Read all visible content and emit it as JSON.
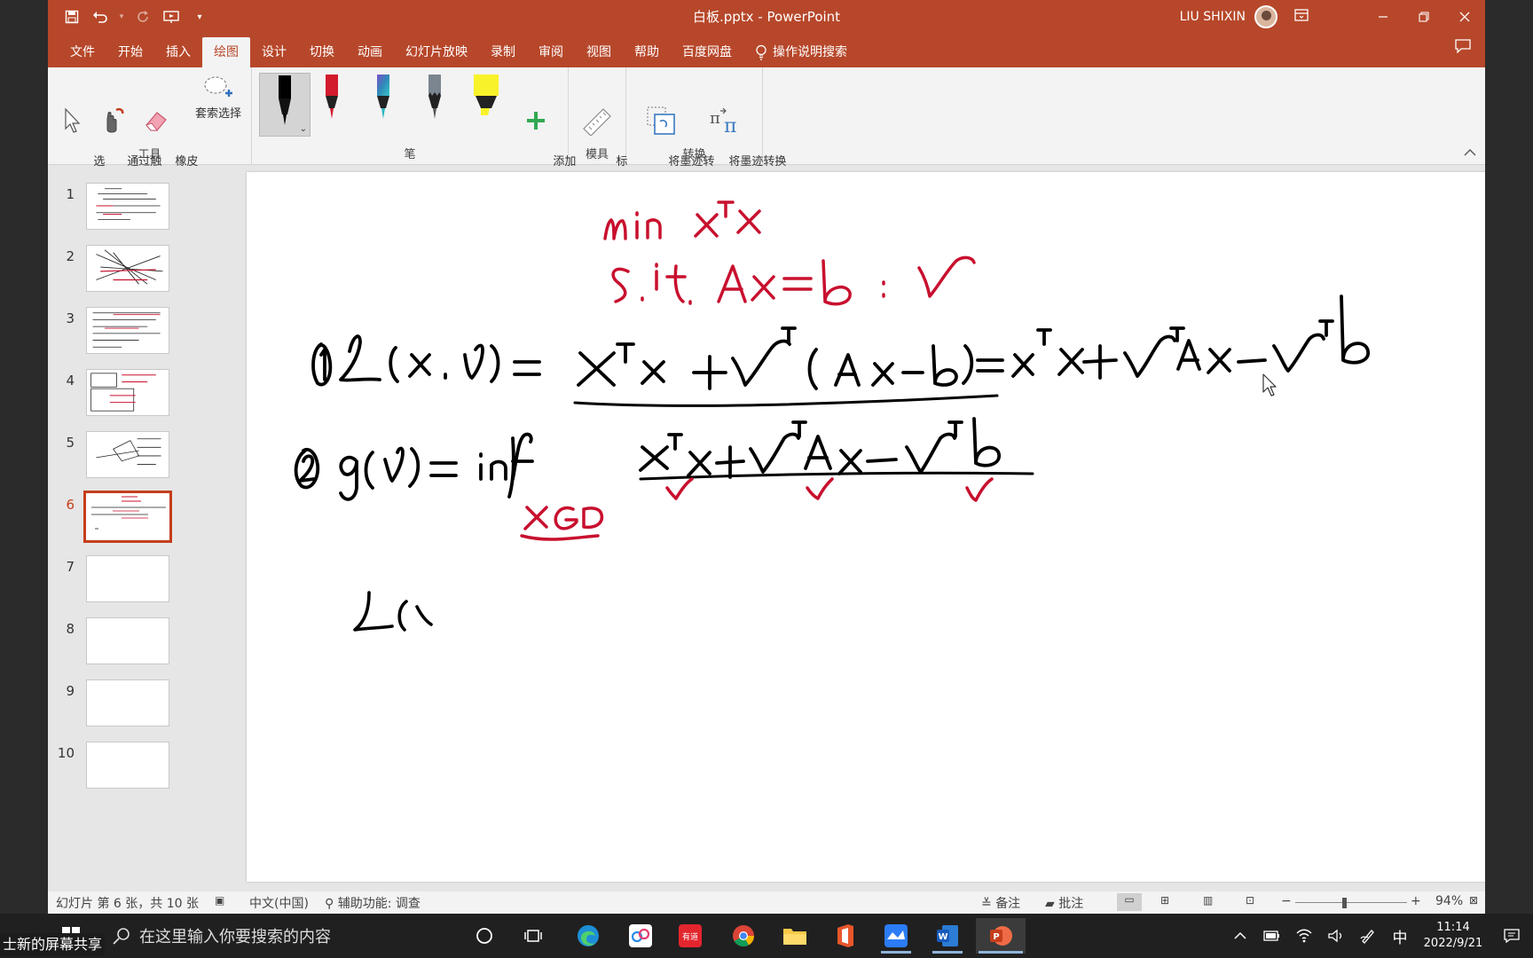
{
  "titlebar": {
    "document_title": "白板.pptx  -  PowerPoint",
    "user_name": "LIU SHIXIN"
  },
  "menu": {
    "tabs": [
      "文件",
      "开始",
      "插入",
      "绘图",
      "设计",
      "切换",
      "动画",
      "幻灯片放映",
      "录制",
      "审阅",
      "视图",
      "帮助",
      "百度网盘"
    ],
    "active_tab": "绘图",
    "tell_me": "操作说明搜索"
  },
  "ribbon": {
    "tools_group": {
      "label": "工具",
      "select": "选\n择",
      "touch_draw": "通过触\n摸绘制",
      "eraser": "橡皮\n擦",
      "lasso": "套索选择"
    },
    "pens_group": {
      "label": "笔",
      "add_pen": "添加\n笔"
    },
    "stencils_group": {
      "label": "模具",
      "ruler": "标\n尺"
    },
    "convert_group": {
      "label": "转换",
      "ink_to_shape": "将墨迹转\n换为形状",
      "ink_to_math": "将墨迹转换\n为数学公式"
    }
  },
  "thumbnails": [
    "1",
    "2",
    "3",
    "4",
    "5",
    "6",
    "7",
    "8",
    "9",
    "10"
  ],
  "active_slide": 6,
  "status": {
    "slide_info": "幻灯片 第 6 张，共 10 张",
    "language": "中文(中国)",
    "accessibility": "辅助功能: 调查",
    "notes": "备注",
    "comments": "批注",
    "zoom": "94%"
  },
  "taskbar": {
    "search_placeholder": "在这里输入你要搜索的内容",
    "time": "11:14",
    "date": "2022/9/21",
    "ime": "中",
    "share_label": "士新的屏幕共享"
  },
  "colors": {
    "accent": "#b7472a",
    "ink_red": "#c8102e",
    "ink_black": "#000000",
    "active_thumb": "#c43e1c"
  }
}
